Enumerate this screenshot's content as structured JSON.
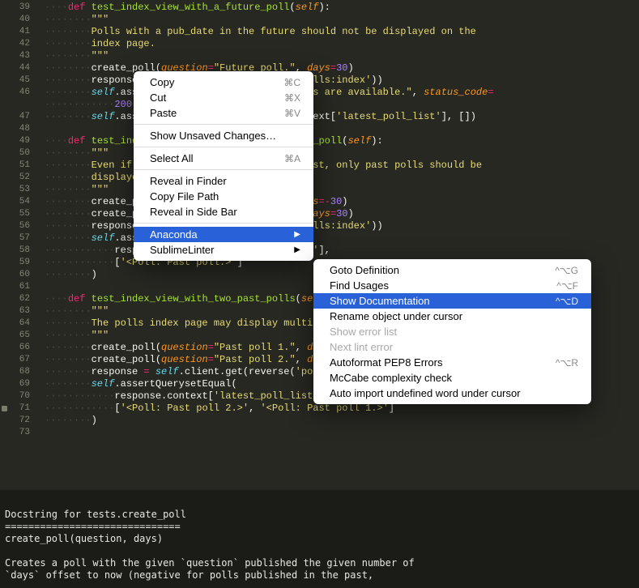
{
  "lines": [
    {
      "n": "39",
      "dots": "····",
      "html": "<span class='storage'>def</span> <span class='fname'>test_index_view_with_a_future_poll</span>(<span class='param'>self</span>):"
    },
    {
      "n": "40",
      "dots": "········",
      "html": "<span class='string'>&quot;&quot;&quot;</span>"
    },
    {
      "n": "41",
      "dots": "········",
      "html": "<span class='string'>Polls with a pub_date in the future should not be displayed on the</span>"
    },
    {
      "n": "42",
      "dots": "········",
      "html": "<span class='string'>index page.</span>"
    },
    {
      "n": "43",
      "dots": "········",
      "html": "<span class='string'>&quot;&quot;&quot;</span>"
    },
    {
      "n": "44",
      "dots": "········",
      "html": "create_poll(<span class='param'>question</span><span class='op'>=</span><span class='string'>&quot;Future poll.&quot;</span>, <span class='param'>days</span><span class='op'>=</span><span class='num'>30</span>)"
    },
    {
      "n": "45",
      "dots": "········",
      "html": "response <span class='op'>=</span> <span class='kw'>self</span>.client.get(reverse(<span class='string'>'polls:index'</span>))"
    },
    {
      "n": "46",
      "dots": "········",
      "html": "<span class='kw'>self</span>.assertContains(response, <span class='string'>&quot;No polls are available.&quot;</span>, <span class='param'>status_code</span><span class='op'>=</span>"
    },
    {
      "n": "",
      "dots": "············",
      "html": "<span class='num'>200</span>)"
    },
    {
      "n": "47",
      "dots": "········",
      "html": "<span class='kw'>self</span>.assertQuerysetEqual(response.context[<span class='string'>'latest_poll_list'</span>], [])"
    },
    {
      "n": "48",
      "dots": "",
      "html": ""
    },
    {
      "n": "49",
      "dots": "····",
      "html": "<span class='storage'>def</span> <span class='fname'>test_index_view_with_a_future_and_past_poll</span>(<span class='param'>self</span>):"
    },
    {
      "n": "50",
      "dots": "········",
      "html": "<span class='string'>&quot;&quot;&quot;</span>"
    },
    {
      "n": "51",
      "dots": "········",
      "html": "<span class='string'>Even if both past and future polls exist, only past polls should be</span>"
    },
    {
      "n": "52",
      "dots": "········",
      "html": "<span class='string'>displayed.</span>"
    },
    {
      "n": "53",
      "dots": "········",
      "html": "<span class='string'>&quot;&quot;&quot;</span>"
    },
    {
      "n": "54",
      "dots": "········",
      "html": "create_poll(<span class='param'>question</span><span class='op'>=</span><span class='string'>&quot;Past poll.&quot;</span>, <span class='param'>days</span><span class='op'>=</span><span class='op'>-</span><span class='num'>30</span>)"
    },
    {
      "n": "55",
      "dots": "········",
      "html": "create_poll(<span class='param'>question</span><span class='op'>=</span><span class='string'>&quot;Future poll.&quot;</span>, <span class='param'>days</span><span class='op'>=</span><span class='num'>30</span>)"
    },
    {
      "n": "56",
      "dots": "········",
      "html": "response <span class='op'>=</span> <span class='kw'>self</span>.client.get(reverse(<span class='string'>'polls:index'</span>))"
    },
    {
      "n": "57",
      "dots": "········",
      "html": "<span class='kw'>self</span>.assertQuerysetEqual("
    },
    {
      "n": "58",
      "dots": "············",
      "html": "response.context[<span class='string'>'latest_poll_list'</span>],"
    },
    {
      "n": "59",
      "dots": "············",
      "html": "[<span class='string'>'&lt;Poll: Past poll.&gt;'</span>]"
    },
    {
      "n": "60",
      "dots": "········",
      "html": ")"
    },
    {
      "n": "61",
      "dots": "",
      "html": ""
    },
    {
      "n": "62",
      "dots": "····",
      "html": "<span class='storage'>def</span> <span class='fname'>test_index_view_with_two_past_polls</span>(<span class='param'>self</span>):"
    },
    {
      "n": "63",
      "dots": "········",
      "html": "<span class='string'>&quot;&quot;&quot;</span>"
    },
    {
      "n": "64",
      "dots": "········",
      "html": "<span class='string'>The polls index page may display multiple polls.</span>"
    },
    {
      "n": "65",
      "dots": "········",
      "html": "<span class='string'>&quot;&quot;&quot;</span>"
    },
    {
      "n": "66",
      "dots": "········",
      "html": "create_poll(<span class='param'>question</span><span class='op'>=</span><span class='string'>&quot;Past poll 1.&quot;</span>, <span class='param'>days</span><span class='op'>=</span><span class='op'>-</span><span class='num'>30</span>)"
    },
    {
      "n": "67",
      "dots": "········",
      "html": "create_poll(<span class='param'>question</span><span class='op'>=</span><span class='string'>&quot;Past poll 2.&quot;</span>, <span class='param'>days</span><span class='op'>=</span><span class='op'>-</span><span class='num'>5</span>)"
    },
    {
      "n": "68",
      "dots": "········",
      "html": "response <span class='op'>=</span> <span class='kw'>self</span>.client.get(reverse(<span class='string'>'polls:index'</span>))"
    },
    {
      "n": "69",
      "dots": "········",
      "html": "<span class='kw'>self</span>.assertQuerysetEqual("
    },
    {
      "n": "70",
      "dots": "············",
      "html": "response.context[<span class='string'>'latest_poll_list'</span>],"
    },
    {
      "n": "71",
      "dots": "············",
      "html": "[<span class='string'>'&lt;Poll: Past poll 2.&gt;'</span>, <span class='string'>'&lt;Poll: Past poll 1.&gt;'</span>]",
      "mark": true
    },
    {
      "n": "72",
      "dots": "········",
      "html": ")"
    },
    {
      "n": "73",
      "dots": "",
      "html": ""
    }
  ],
  "menu1": [
    {
      "type": "item",
      "label": "Copy",
      "sc": "⌘C"
    },
    {
      "type": "item",
      "label": "Cut",
      "sc": "⌘X"
    },
    {
      "type": "item",
      "label": "Paste",
      "sc": "⌘V"
    },
    {
      "type": "sep"
    },
    {
      "type": "item",
      "label": "Show Unsaved Changes…"
    },
    {
      "type": "sep"
    },
    {
      "type": "item",
      "label": "Select All",
      "sc": "⌘A"
    },
    {
      "type": "sep"
    },
    {
      "type": "item",
      "label": "Reveal in Finder"
    },
    {
      "type": "item",
      "label": "Copy File Path"
    },
    {
      "type": "item",
      "label": "Reveal in Side Bar"
    },
    {
      "type": "sep"
    },
    {
      "type": "item",
      "label": "Anaconda",
      "sub": true,
      "hi": true
    },
    {
      "type": "item",
      "label": "SublimeLinter",
      "sub": true
    }
  ],
  "menu2": [
    {
      "type": "item",
      "label": "Goto Definition",
      "sc": "^⌥G"
    },
    {
      "type": "item",
      "label": "Find Usages",
      "sc": "^⌥F"
    },
    {
      "type": "item",
      "label": "Show Documentation",
      "sc": "^⌥D",
      "hi": true
    },
    {
      "type": "item",
      "label": "Rename object under cursor"
    },
    {
      "type": "item",
      "label": "Show error list",
      "dis": true
    },
    {
      "type": "item",
      "label": "Next lint error",
      "dis": true
    },
    {
      "type": "item",
      "label": "Autoformat PEP8 Errors",
      "sc": "^⌥R"
    },
    {
      "type": "item",
      "label": "McCabe complexity check"
    },
    {
      "type": "item",
      "label": "Auto import undefined word under cursor"
    }
  ],
  "doc": {
    "title": "Docstring for tests.create_poll",
    "rule": "==============================",
    "sig": "create_poll(question, days)",
    "body1": "Creates a poll with the given `question` published the given number of",
    "body2": "`days` offset to now (negative for polls published in the past,"
  }
}
